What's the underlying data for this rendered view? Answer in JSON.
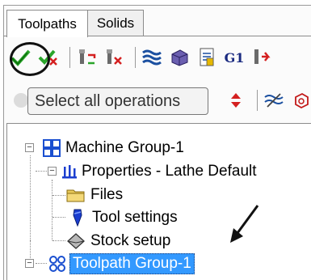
{
  "tabs": [
    {
      "label": "Toolpaths",
      "active": true
    },
    {
      "label": "Solids",
      "active": false
    }
  ],
  "toolbar1": {
    "icons": [
      "select-all-operations-icon",
      "deselect-operations-icon",
      "regenerate-tools-icon",
      "delete-tools-icon",
      "wave-toolpath-icon",
      "stock-model-icon",
      "report-icon",
      "g1-icon",
      "post-output-icon"
    ],
    "g1_label": "G1"
  },
  "toolbar2": {
    "icons": [
      "move-down-icon",
      "lock-toolpath-icon",
      "display-toggle-icon",
      "stock-display-icon"
    ]
  },
  "tooltip": {
    "text": "Select all operations"
  },
  "tree": {
    "machine_group": "Machine Group-1",
    "properties": "Properties - Lathe Default",
    "files": "Files",
    "tool_settings": "Tool settings",
    "stock_setup": "Stock setup",
    "toolpath_group": "Toolpath Group-1"
  },
  "colors": {
    "selection": "#3399ff",
    "accent_green": "#2aa52a",
    "accent_red": "#d42020"
  }
}
